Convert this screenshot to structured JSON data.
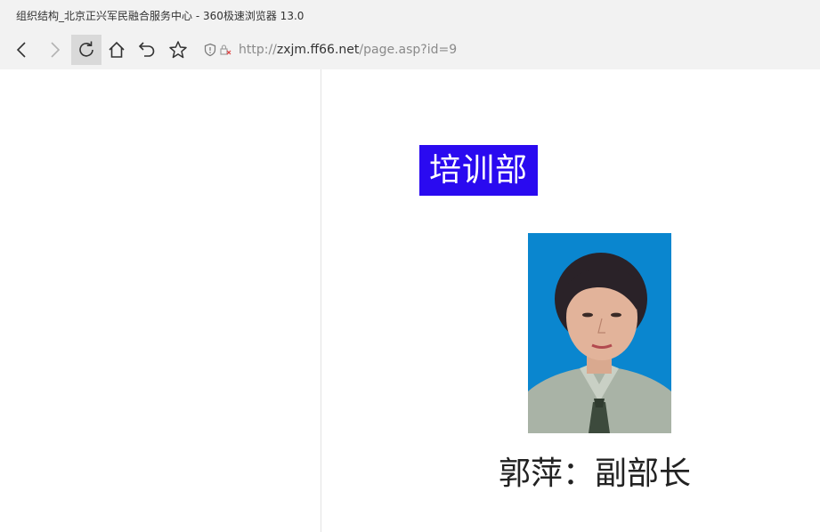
{
  "window": {
    "title": "组织结构_北京正兴军民融合服务中心 - 360极速浏览器 13.0"
  },
  "toolbar": {
    "buttons": [
      {
        "name": "back",
        "icon": "chevron-left-icon"
      },
      {
        "name": "forward",
        "icon": "chevron-right-icon"
      },
      {
        "name": "reload",
        "icon": "reload-icon"
      },
      {
        "name": "home",
        "icon": "home-icon"
      },
      {
        "name": "undo",
        "icon": "undo-icon"
      },
      {
        "name": "favorite",
        "icon": "star-icon"
      }
    ],
    "address": {
      "scheme": "http://",
      "host": "zxjm.ff66.net",
      "path": "/page.asp?id=9"
    }
  },
  "page": {
    "department": "培训部",
    "caption": "郭萍：副部长",
    "photo": {
      "icon": "portrait-photo",
      "background_color": "#0a86cf"
    }
  },
  "colors": {
    "chrome": "#f2f2f2",
    "badge": "#2a0af0"
  }
}
